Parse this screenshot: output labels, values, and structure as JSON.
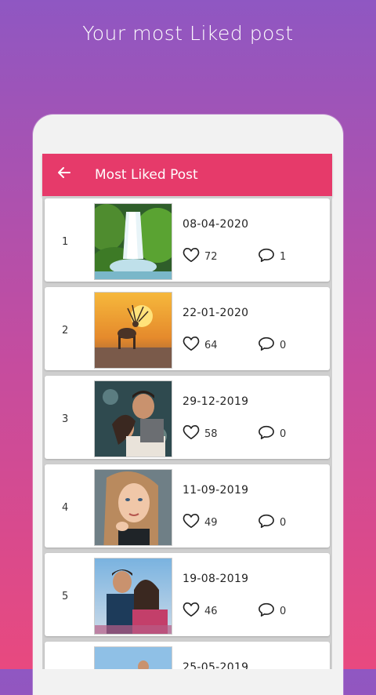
{
  "headline": "Your most Liked post",
  "appbar": {
    "title": "Most Liked Post",
    "back_icon": "arrow-left-icon"
  },
  "accent_color": "#e63a6a",
  "posts": [
    {
      "rank": "1",
      "date": "08-04-2020",
      "likes": "72",
      "comments": "1",
      "image": "waterfall"
    },
    {
      "rank": "2",
      "date": "22-01-2020",
      "likes": "64",
      "comments": "0",
      "image": "deer-sunset"
    },
    {
      "rank": "3",
      "date": "29-12-2019",
      "likes": "58",
      "comments": "0",
      "image": "couple"
    },
    {
      "rank": "4",
      "date": "11-09-2019",
      "likes": "49",
      "comments": "0",
      "image": "woman-portrait"
    },
    {
      "rank": "5",
      "date": "19-08-2019",
      "likes": "46",
      "comments": "0",
      "image": "couple-outdoor"
    },
    {
      "rank": "",
      "date": "25-05-2019",
      "likes": "",
      "comments": "",
      "image": "couple-sky"
    }
  ]
}
